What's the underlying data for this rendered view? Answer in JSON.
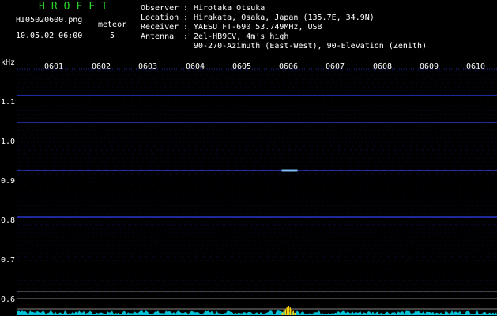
{
  "header": {
    "brand": "HROFFT",
    "filename": "HI05020600.png",
    "datetime": "10.05.02 06:00",
    "meteor_label": "meteor",
    "meteor_count": "5",
    "info": [
      {
        "key": "Observer",
        "value": "Hirotaka Otsuka"
      },
      {
        "key": "Location",
        "value": "Hirakata, Osaka, Japan (135.7E, 34.9N)"
      },
      {
        "key": "Receiver",
        "value": "YAESU FT-690 53.749MHz, USB"
      },
      {
        "key": "Antenna",
        "value": "2el-HB9CV, 4m's high"
      }
    ],
    "antenna_line2": "90-270-Azimuth (East-West), 90-Elevation (Zenith)"
  },
  "axis": {
    "y_unit": "kHz",
    "x_ticks": [
      "0601",
      "0602",
      "0603",
      "0604",
      "0605",
      "0606",
      "0607",
      "0608",
      "0609",
      "0610"
    ],
    "y_ticks": [
      "1.1",
      "1.0",
      "0.9",
      "0.8",
      "0.7",
      "0.6"
    ]
  },
  "colors": {
    "background": "#000000",
    "brand": "#28d828",
    "signal": "#3344ff",
    "echo": "#88ccff",
    "spectrum": "#00e5ff",
    "peak": "#ffd000",
    "text": "#ffffff"
  },
  "chart_data": {
    "type": "heatmap",
    "title": "",
    "xlabel": "",
    "ylabel": "kHz",
    "x_range": [
      "0601",
      "0610"
    ],
    "ylim": [
      0.58,
      1.15
    ],
    "carrier_lines_khz": [
      1.118,
      1.05,
      0.928,
      0.81
    ],
    "meteor_echoes": [
      {
        "time": "0606",
        "freq_khz": 0.928
      }
    ]
  }
}
